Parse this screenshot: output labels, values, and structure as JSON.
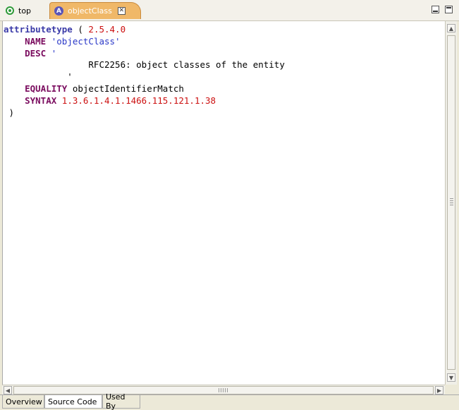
{
  "tabs": [
    {
      "label": "top",
      "icon": "circle-dot-icon",
      "active": false
    },
    {
      "label": "objectClass",
      "icon": "attribute-a-icon",
      "active": true
    }
  ],
  "active_tab_icon_letter": "A",
  "close_glyph": "✕",
  "code": {
    "line1": {
      "kw": "attributetype",
      "paren": " ( ",
      "oid": "2.5.4.0"
    },
    "line2": {
      "indent": "    ",
      "kw": "NAME",
      "sp": " ",
      "quote": "'objectClass'"
    },
    "line3": {
      "indent": "    ",
      "kw": "DESC",
      "sp": " ",
      "quote": "'"
    },
    "line4": {
      "text": "                RFC2256: object classes of the entity"
    },
    "line5": {
      "text": "            '"
    },
    "line6": {
      "indent": "    ",
      "kw": "EQUALITY",
      "rest": " objectIdentifierMatch"
    },
    "line7": {
      "indent": "    ",
      "kw": "SYNTAX",
      "sp": " ",
      "oid": "1.3.6.1.4.1.1466.115.121.1.38"
    },
    "line8": {
      "text": " )"
    }
  },
  "bottom_tabs": [
    {
      "label": "Overview",
      "active": false
    },
    {
      "label": "Source Code",
      "active": true
    },
    {
      "label": "Used By",
      "active": false
    }
  ],
  "colors": {
    "keyword": "#7a0b5e",
    "keyword_blue": "#3b3ba8",
    "number": "#cc1010",
    "string": "#2a38c8",
    "active_tab": "#f0b868"
  }
}
